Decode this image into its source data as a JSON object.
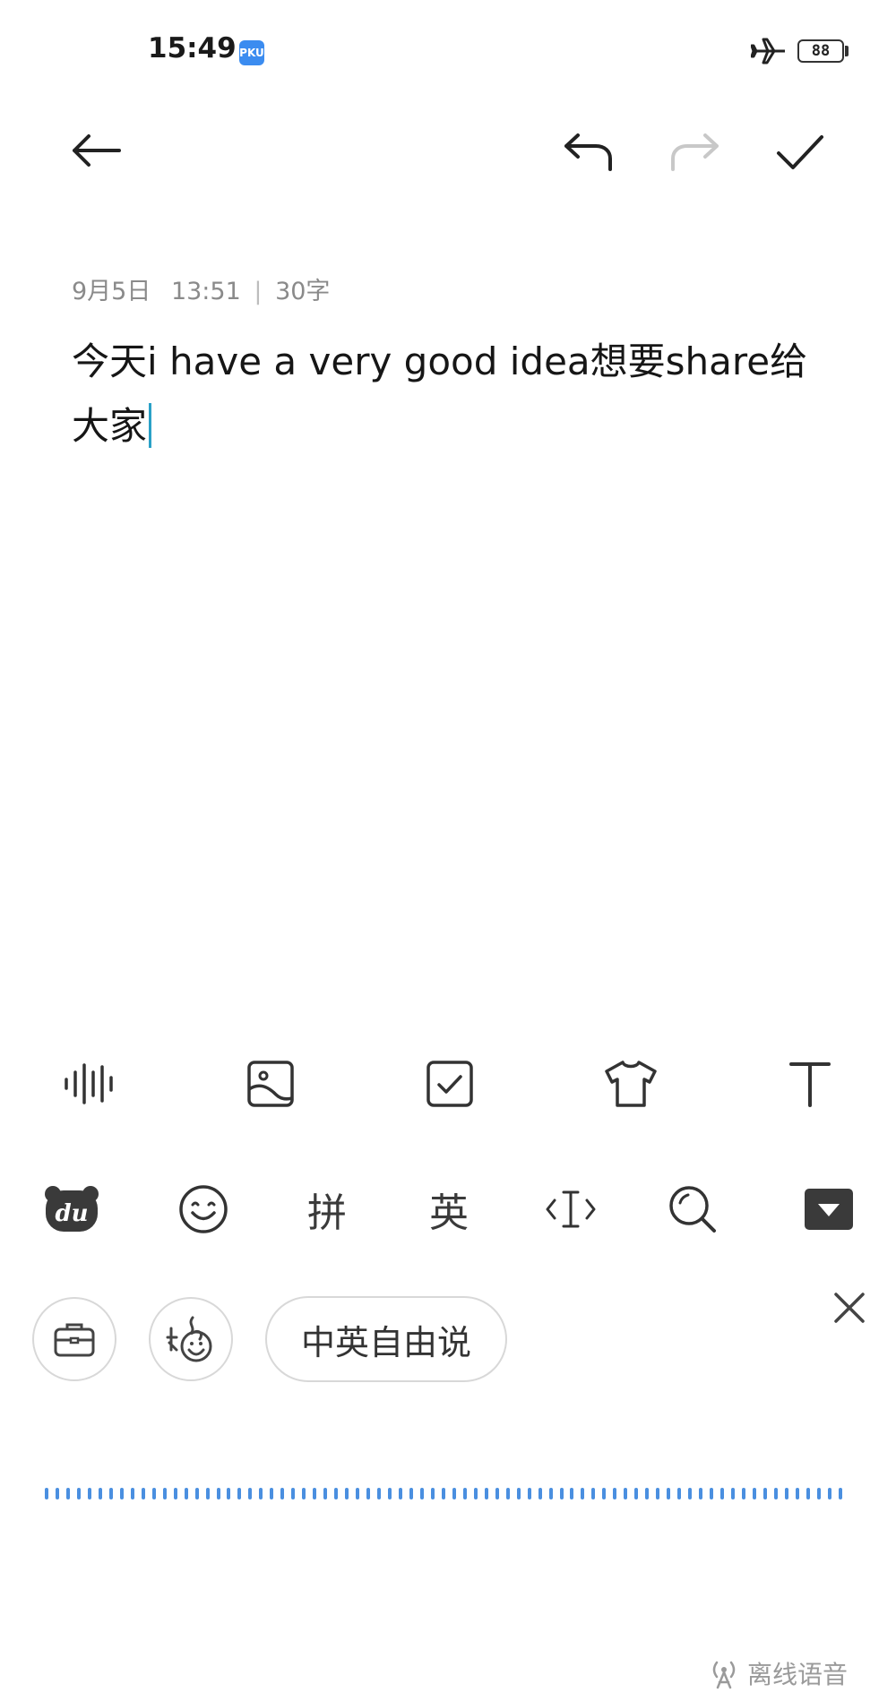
{
  "status_bar": {
    "time": "15:49",
    "app_badge": "PKU",
    "battery": "88",
    "icons": [
      "airplane-mode-icon",
      "battery-icon"
    ]
  },
  "toolbar": {
    "back_icon": "back-arrow-icon",
    "undo_icon": "undo-icon",
    "redo_icon": "redo-icon",
    "done_icon": "checkmark-icon"
  },
  "note": {
    "date": "9月5日",
    "time": "13:51",
    "separator": "|",
    "char_count": "30字",
    "text": "今天i have a very good idea想要share给大家"
  },
  "format_toolbar": {
    "items": [
      "voice-wave-icon",
      "image-icon",
      "checkbox-icon",
      "theme-shirt-icon",
      "text-format-icon"
    ]
  },
  "ime_toolbar": {
    "pinyin_label": "拼",
    "english_label": "英",
    "items": [
      "du-bear-logo-icon",
      "emoji-icon",
      "pinyin-key",
      "english-key",
      "cursor-move-icon",
      "search-icon",
      "hide-keyboard-icon"
    ]
  },
  "voice_panel": {
    "mode_label": "中英自由说",
    "offline_label": "离线语音"
  },
  "colors": {
    "accent_wave": "#4a8fe0",
    "caret": "#2aa1c7",
    "redo_disabled": "#c8c8c8"
  }
}
